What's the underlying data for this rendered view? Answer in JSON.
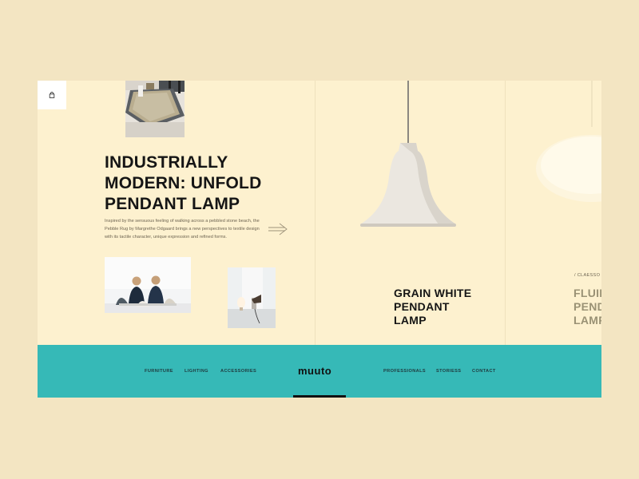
{
  "article": {
    "headline_line1": "INDUSTRIALLY",
    "headline_line2": "MODERN: UNFOLD",
    "headline_line3": "PENDANT LAMP",
    "description": "Inspired by the sensuous feeling of walking across a pebbled stone beach, the Pebble Rug by Margrethe Odgaard brings a new perspectives to textile design with its tactile character, unique expression and refined forms."
  },
  "products": [
    {
      "title_line1": "GRAIN WHITE",
      "title_line2": "PENDANT",
      "title_line3": "LAMP"
    },
    {
      "crumb": "/  CLAESSO",
      "title_line1": "FLUID",
      "title_line2": "PEND",
      "title_line3": "LAMP"
    }
  ],
  "nav": {
    "left": [
      "FURNITURE",
      "LIGHTING",
      "ACCESSORIES"
    ],
    "brand": "muuto",
    "right": [
      "PROFESSIONALS",
      "STORIESS",
      "CONTACT"
    ]
  },
  "colors": {
    "page_bg": "#f3e5c2",
    "panel_bg": "#fdf1cf",
    "nav_bg": "#36b9b7",
    "text_dark": "#151515"
  },
  "icons": {
    "cart": "shopping-bag-icon",
    "next": "arrow-right-icon"
  }
}
